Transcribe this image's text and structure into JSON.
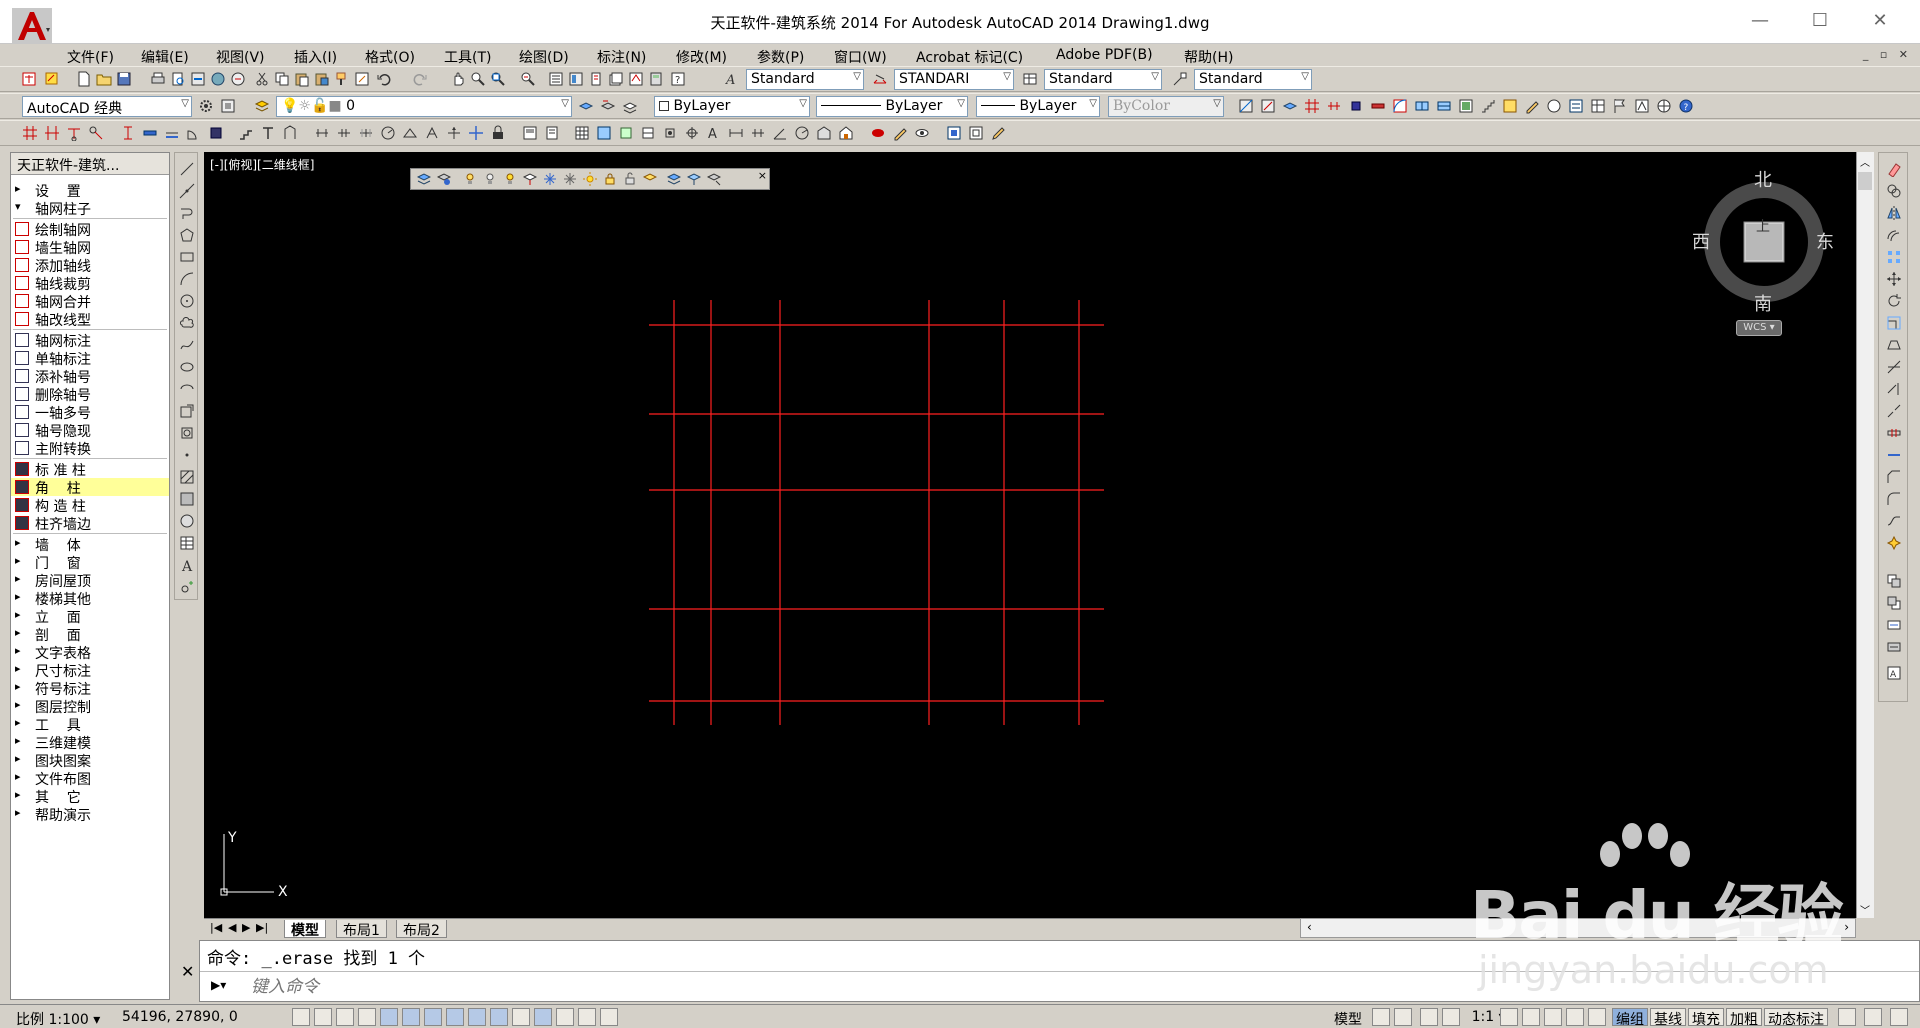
{
  "window": {
    "title": "天正软件-建筑系统 2014  For Autodesk AutoCAD 2014      Drawing1.dwg",
    "app_logo_letter": "A",
    "minimize": "—",
    "maximize": "☐",
    "close": "✕"
  },
  "menu": {
    "items": [
      "文件(F)",
      "编辑(E)",
      "视图(V)",
      "插入(I)",
      "格式(O)",
      "工具(T)",
      "绘图(D)",
      "标注(N)",
      "修改(M)",
      "参数(P)",
      "窗口(W)",
      "Acrobat 标记(C)",
      "Adobe PDF(B)",
      "帮助(H)"
    ]
  },
  "toolbar1": {
    "text_style": "Standard",
    "dim_style": "STANDARI",
    "table_style": "Standard",
    "mleader_style": "Standard"
  },
  "toolbar2": {
    "workspace": "AutoCAD 经典",
    "layer": "0",
    "color": "ByLayer",
    "linetype": "ByLayer",
    "lineweight": "ByLayer",
    "plotstyle": "ByColor"
  },
  "tz_panel": {
    "title": "天正软件-建筑...",
    "items": [
      {
        "label": "设    置",
        "type": "expand"
      },
      {
        "label": "轴网柱子",
        "type": "collapse"
      },
      {
        "label": "绘制轴网",
        "type": "cmd"
      },
      {
        "label": "墙生轴网",
        "type": "cmd"
      },
      {
        "label": "添加轴线",
        "type": "cmd"
      },
      {
        "label": "轴线裁剪",
        "type": "cmd"
      },
      {
        "label": "轴网合并",
        "type": "cmd"
      },
      {
        "label": "轴改线型",
        "type": "cmd"
      },
      {
        "label": "轴网标注",
        "type": "cmd"
      },
      {
        "label": "单轴标注",
        "type": "cmd"
      },
      {
        "label": "添补轴号",
        "type": "cmd"
      },
      {
        "label": "删除轴号",
        "type": "cmd"
      },
      {
        "label": "一轴多号",
        "type": "cmd"
      },
      {
        "label": "轴号隐现",
        "type": "cmd"
      },
      {
        "label": "主附转换",
        "type": "cmd"
      },
      {
        "label": "标 准 柱",
        "type": "cmd"
      },
      {
        "label": "角    柱",
        "type": "cmd"
      },
      {
        "label": "构 造 柱",
        "type": "cmd"
      },
      {
        "label": "柱齐墙边",
        "type": "cmd"
      },
      {
        "label": "墙    体",
        "type": "expand"
      },
      {
        "label": "门    窗",
        "type": "expand"
      },
      {
        "label": "房间屋顶",
        "type": "expand"
      },
      {
        "label": "楼梯其他",
        "type": "expand"
      },
      {
        "label": "立    面",
        "type": "expand"
      },
      {
        "label": "剖    面",
        "type": "expand"
      },
      {
        "label": "文字表格",
        "type": "expand"
      },
      {
        "label": "尺寸标注",
        "type": "expand"
      },
      {
        "label": "符号标注",
        "type": "expand"
      },
      {
        "label": "图层控制",
        "type": "expand"
      },
      {
        "label": "工    具",
        "type": "expand"
      },
      {
        "label": "三维建模",
        "type": "expand"
      },
      {
        "label": "图块图案",
        "type": "expand"
      },
      {
        "label": "文件布图",
        "type": "expand"
      },
      {
        "label": "其    它",
        "type": "expand"
      },
      {
        "label": "帮助演示",
        "type": "expand"
      }
    ]
  },
  "canvas": {
    "viewport_label": "[-][俯视][二维线框]",
    "ucs_x": "X",
    "ucs_y": "Y",
    "grid_color": "#ff2020"
  },
  "viewcube": {
    "north": "北",
    "south": "南",
    "east": "东",
    "west": "西",
    "face": "上",
    "wcs": "WCS"
  },
  "layout_tabs": {
    "tabs": [
      "模型",
      "布局1",
      "布局2"
    ],
    "active": 0
  },
  "command": {
    "history": "命令: _.erase 找到 1 个",
    "placeholder": "键入命令"
  },
  "statusbar": {
    "scale": "比例 1:100",
    "coords": "54196, 27890, 0",
    "model": "模型",
    "anno_scale": "1:1",
    "toggles": [
      "编组",
      "基线",
      "填充",
      "加粗",
      "动态标注"
    ]
  },
  "watermark": {
    "brand": "Bai du 经验",
    "url": "jingyan.baidu.com"
  }
}
